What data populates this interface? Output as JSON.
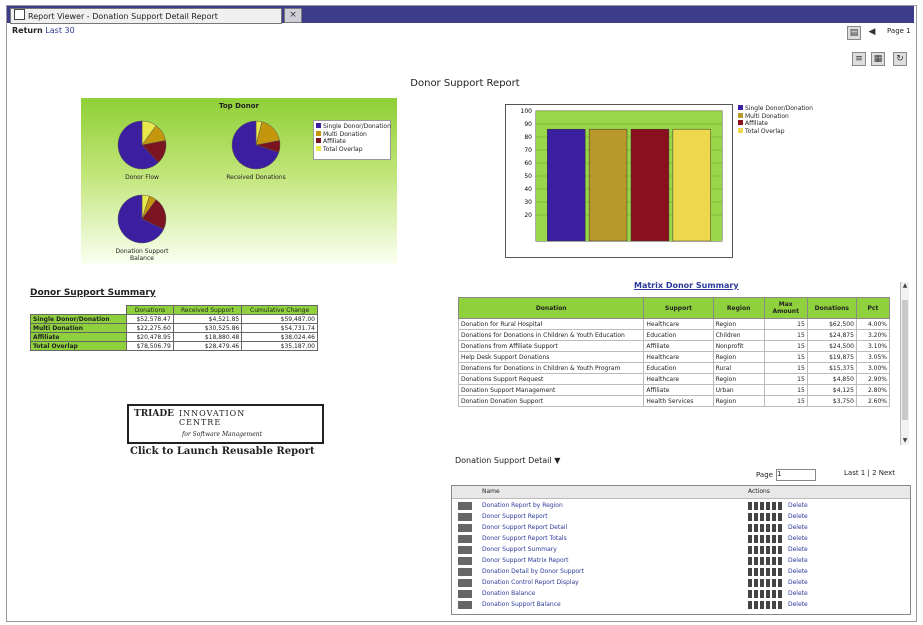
{
  "window": {
    "tab_title": "Report Viewer - Donation Support Detail Report",
    "tab_close": "×"
  },
  "toolbar": {
    "return_label": "Return",
    "return_value": "Last 30",
    "page_label": "Page 1"
  },
  "report": {
    "title": "Donor Support Report"
  },
  "pie_panel": {
    "title": "Top Donor",
    "legend": [
      "Single Donor/Donation",
      "Multi Donation",
      "Affiliate",
      "Total Overlap"
    ],
    "legend_colors": [
      "#3b1fa0",
      "#c4960c",
      "#7a1420",
      "#e8e84a"
    ],
    "pies": [
      {
        "label": "Donor Flow",
        "slices": [
          0.62,
          0.12,
          0.16,
          0.1
        ]
      },
      {
        "label": "Received Donations",
        "slices": [
          0.7,
          0.18,
          0.08,
          0.04
        ]
      },
      {
        "label": "Donation Support Balance",
        "slices": [
          0.68,
          0.05,
          0.22,
          0.05
        ]
      }
    ]
  },
  "chart_data": {
    "type": "bar",
    "categories": [
      "Single Donor/Donation",
      "Multi Donation",
      "Affiliate",
      "Total Overlap"
    ],
    "values": [
      86,
      86,
      86,
      86
    ],
    "colors": [
      "#3b1fa0",
      "#b8982a",
      "#8a1020",
      "#ecd84a"
    ],
    "legend": [
      "Single Donor/Donation",
      "Multi Donation",
      "Affiliate",
      "Total Overlap"
    ],
    "ylabels": [
      "100",
      "90",
      "80",
      "70",
      "60",
      "50",
      "40",
      "30",
      "20"
    ],
    "ylim": [
      0,
      100
    ],
    "legend_position": "right"
  },
  "summary": {
    "title": "Donor Support Summary",
    "headers": [
      "",
      "Donations",
      "Received Support",
      "Cumulative Change"
    ],
    "rows": [
      [
        "Single Donor/Donation",
        "$52,578.47",
        "$4,521.85",
        "$59,487.00"
      ],
      [
        "Multi Donation",
        "$22,275.60",
        "$30,525.86",
        "$54,731.74"
      ],
      [
        "Affiliate",
        "$20,478.95",
        "$18,880.48",
        "$38,024.46"
      ],
      [
        "Total Overlap",
        "$78,506.79",
        "$28,479.46",
        "$35,187.00"
      ]
    ]
  },
  "logo": {
    "brand_left": "TRIADE",
    "brand_right_1": "INNOVATION",
    "brand_right_2": "CENTRE",
    "tagline": "for Software Management",
    "caption": "Click to Launch Reusable Report"
  },
  "matrix": {
    "title": "Matrix Donor Summary",
    "headers": [
      "Donation",
      "Support",
      "Region",
      "Max Amount",
      "Donations",
      "Pct"
    ],
    "rows": [
      [
        "Donation for Rural Hospital",
        "Healthcare",
        "Region",
        "15",
        "$62,500",
        "4.00%"
      ],
      [
        "Donations for Donations in Children & Youth Education",
        "Education",
        "Children",
        "15",
        "$24,875",
        "3.20%"
      ],
      [
        "Donations from Affiliate Support",
        "Affiliate",
        "Nonprofit",
        "15",
        "$24,500",
        "3.10%"
      ],
      [
        "Help Desk Support Donations",
        "Healthcare",
        "Region",
        "15",
        "$19,875",
        "3.05%"
      ],
      [
        "Donations for Donations in Children & Youth Program",
        "Education",
        "Rural",
        "15",
        "$15,375",
        "3.00%"
      ],
      [
        "Donations Support Request",
        "Healthcare",
        "Region",
        "15",
        "$4,850",
        "2.90%"
      ],
      [
        "Donation Support Management",
        "Affiliate",
        "Urban",
        "15",
        "$4,125",
        "2.80%"
      ],
      [
        "Donation Donation Support",
        "Health Services",
        "Region",
        "15",
        "$3,750",
        "2.60%"
      ]
    ]
  },
  "report_list": {
    "section_label": "Donation Support Detail",
    "page_label": "Page",
    "page_value": "1",
    "pager_links": "Last 1 | 2 Next",
    "column_name": "Name",
    "column_actions": "Actions",
    "action_text": "Delete",
    "items": [
      "Donation Report by Region",
      "Donor Support Report",
      "Donor Support Report Detail",
      "Donor Support Report Totals",
      "Donor Support Summary",
      "Donor Support Matrix Report",
      "Donation Detail by Donor Support",
      "Donation Control Report Display",
      "Donation Balance",
      "Donation Support Balance"
    ]
  }
}
